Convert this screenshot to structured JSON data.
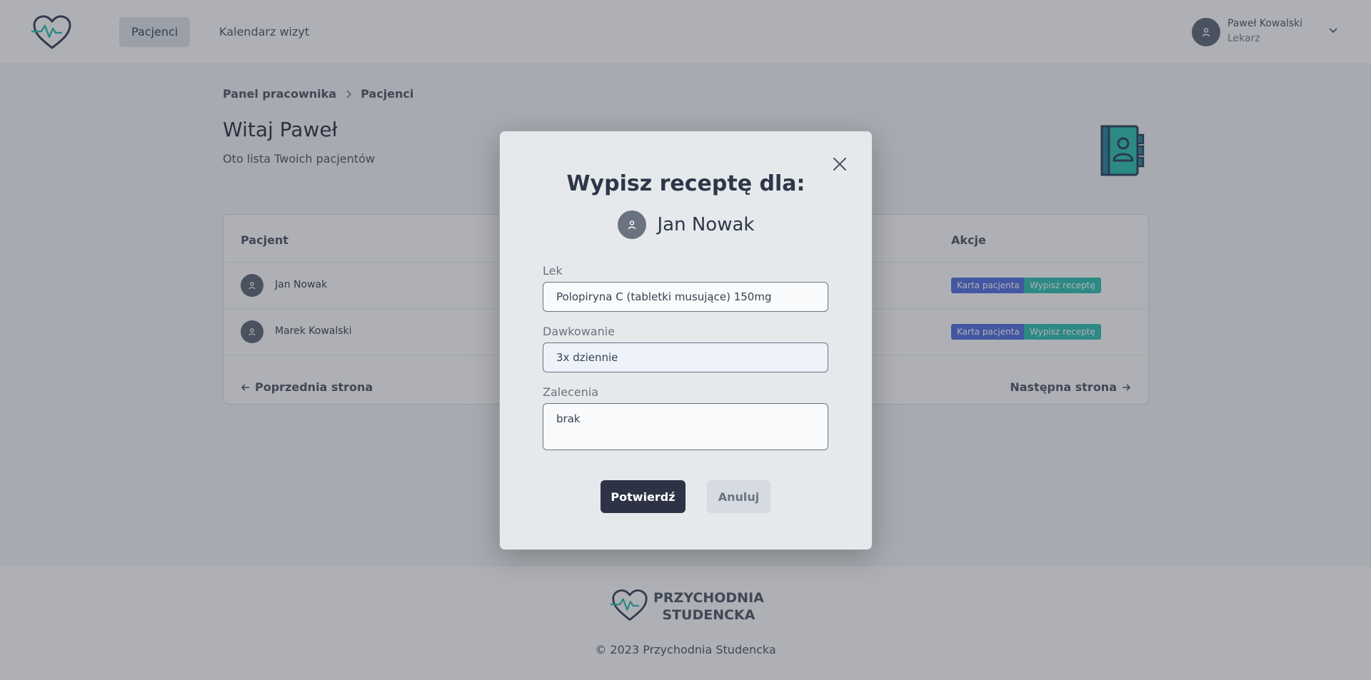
{
  "header": {
    "nav": [
      {
        "label": "Pacjenci",
        "active": true
      },
      {
        "label": "Kalendarz wizyt",
        "active": false
      }
    ],
    "user": {
      "name": "Paweł Kowalski",
      "role": "Lekarz"
    }
  },
  "breadcrumb": [
    "Panel pracownika",
    "Pacjenci"
  ],
  "page": {
    "title": "Witaj Paweł",
    "subtitle": "Oto lista Twoich pacjentów"
  },
  "table": {
    "headers": {
      "patient": "Pacjent",
      "actions": "Akcje"
    },
    "rows": [
      {
        "name": "Jan Nowak",
        "card": "Karta pacjenta",
        "prescribe": "Wypisz receptę"
      },
      {
        "name": "Marek Kowalski",
        "card": "Karta pacjenta",
        "prescribe": "Wypisz receptę"
      }
    ],
    "prev": "Poprzednia strona",
    "next": "Następna strona"
  },
  "footer": {
    "brand_line1": "PRZYCHODNIA",
    "brand_line2": "STUDENCKA",
    "copyright": "© 2023 Przychodnia Studencka"
  },
  "modal": {
    "title": "Wypisz receptę dla:",
    "patient": "Jan Nowak",
    "drug_label": "Lek",
    "drug_value": "Polopiryna C (tabletki musujące) 150mg",
    "dosage_label": "Dawkowanie",
    "dosage_value": "3x dziennie",
    "notes_label": "Zalecenia",
    "notes_value": "brak",
    "confirm": "Potwierdź",
    "cancel": "Anuluj"
  },
  "colors": {
    "brand_dark": "#1f2a44",
    "brand_teal": "#14b8a6",
    "badge_blue": "#3b5bdb",
    "confirm_button": "#2d3344"
  },
  "icons": [
    "heart-pulse-logo-icon",
    "user-icon",
    "chevron-down-icon",
    "chevron-right-icon",
    "address-book-icon",
    "arrow-left-icon",
    "arrow-right-icon",
    "close-icon"
  ]
}
